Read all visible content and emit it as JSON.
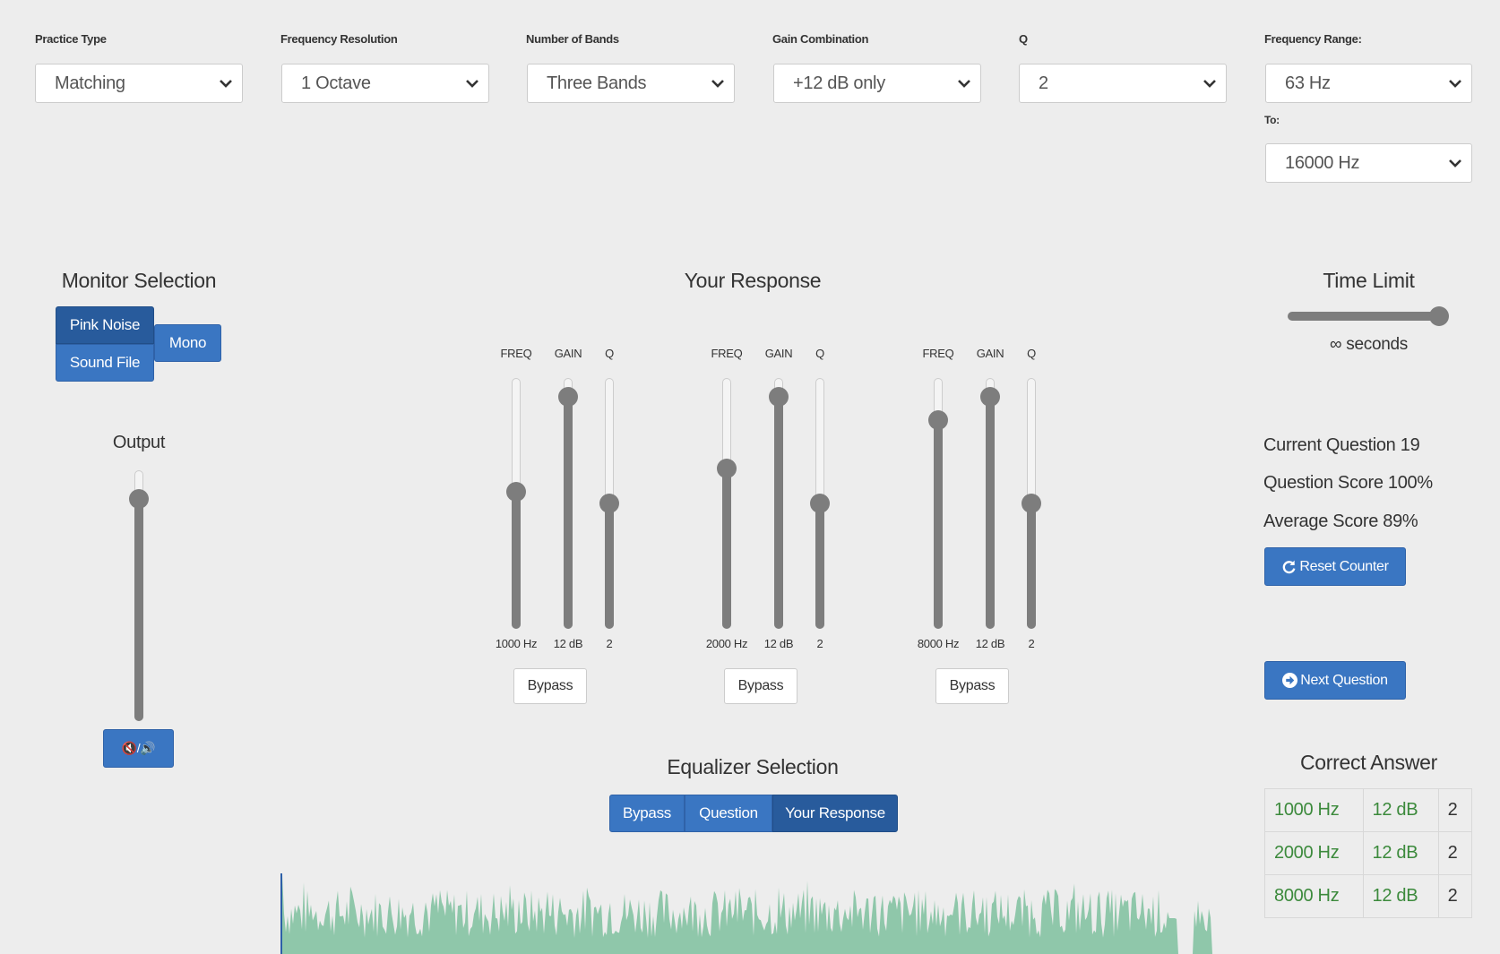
{
  "settings": {
    "practice_type": {
      "label": "Practice Type",
      "value": "Matching"
    },
    "frequency_resolution": {
      "label": "Frequency Resolution",
      "value": "1 Octave"
    },
    "number_of_bands": {
      "label": "Number of Bands",
      "value": "Three Bands"
    },
    "gain_combination": {
      "label": "Gain Combination",
      "value": "+12 dB only"
    },
    "q": {
      "label": "Q",
      "value": "2"
    },
    "frequency_range": {
      "label": "Frequency Range:",
      "from_value": "63 Hz",
      "to_label": "To:",
      "to_value": "16000 Hz"
    }
  },
  "monitor": {
    "title": "Monitor Selection",
    "pink_noise": "Pink Noise",
    "sound_file": "Sound File",
    "mono": "Mono",
    "output_label": "Output",
    "output_level": 0.92,
    "mute_label": "🔇/🔊"
  },
  "response": {
    "title": "Your Response",
    "column_labels": {
      "freq": "FREQ",
      "gain": "GAIN",
      "q": "Q"
    },
    "bypass_label": "Bypass",
    "bands": [
      {
        "freq": "1000 Hz",
        "gain": "12 dB",
        "q": "2",
        "freq_level": 0.55,
        "gain_level": 0.96,
        "q_level": 0.5
      },
      {
        "freq": "2000 Hz",
        "gain": "12 dB",
        "q": "2",
        "freq_level": 0.65,
        "gain_level": 0.96,
        "q_level": 0.5
      },
      {
        "freq": "8000 Hz",
        "gain": "12 dB",
        "q": "2",
        "freq_level": 0.86,
        "gain_level": 0.96,
        "q_level": 0.5
      }
    ]
  },
  "equalizer": {
    "title": "Equalizer Selection",
    "options": [
      "Bypass",
      "Question",
      "Your Response"
    ],
    "active": "Your Response"
  },
  "time_limit": {
    "title": "Time Limit",
    "value_text": "∞ seconds",
    "level": 1.0
  },
  "stats": {
    "current_question": "Current Question 19",
    "question_score": "Question Score 100%",
    "average_score": "Average Score 89%",
    "reset_label": "Reset Counter",
    "next_label": "Next Question"
  },
  "correct_answer": {
    "title": "Correct Answer",
    "rows": [
      [
        "1000 Hz",
        "12 dB",
        "2"
      ],
      [
        "2000 Hz",
        "12 dB",
        "2"
      ],
      [
        "8000 Hz",
        "12 dB",
        "2"
      ]
    ]
  },
  "colors": {
    "accent": "#3a76c2",
    "accent_active": "#285b9c",
    "waveform": "#8fc7aa",
    "answer_text": "#3c8a3c"
  }
}
